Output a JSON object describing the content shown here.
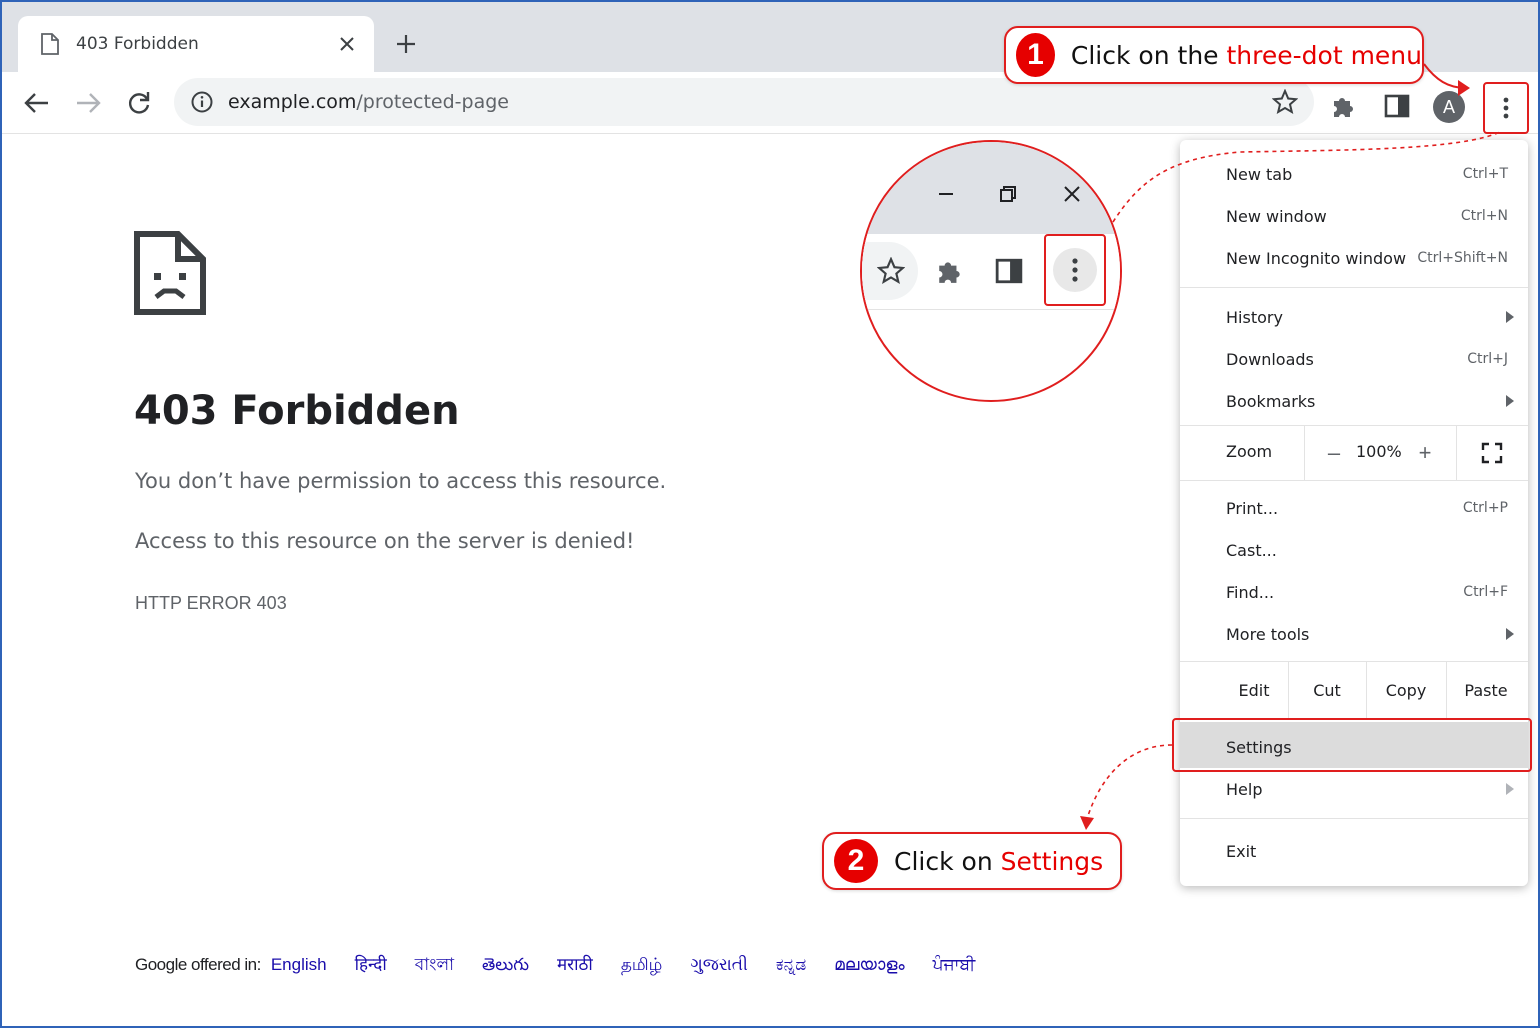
{
  "tab": {
    "title": "403 Forbidden"
  },
  "omnibox": {
    "domain": "example.com",
    "path": "/protected-page"
  },
  "avatar": {
    "initial": "A"
  },
  "page": {
    "title": "403 Forbidden",
    "message1": "You don’t have permission to access this resource.",
    "message2": "Access to this resource on the server is denied!",
    "code": "HTTP ERROR 403"
  },
  "languages": {
    "label": "Google offered in:",
    "items": [
      "English",
      "हिन्दी",
      "বাংলা",
      "తెలుగు",
      "मराठी",
      "தமிழ்",
      "ગુજરાતી",
      "ಕನ್ನಡ",
      "മലയാളം",
      "ਪੰਜਾਬੀ"
    ]
  },
  "menu": {
    "new_tab": {
      "label": "New tab",
      "shortcut": "Ctrl+T"
    },
    "new_window": {
      "label": "New window",
      "shortcut": "Ctrl+N"
    },
    "new_incognito": {
      "label": "New Incognito window",
      "shortcut": "Ctrl+Shift+N"
    },
    "history": {
      "label": "History"
    },
    "downloads": {
      "label": "Downloads",
      "shortcut": "Ctrl+J"
    },
    "bookmarks": {
      "label": "Bookmarks"
    },
    "zoom": {
      "label": "Zoom",
      "value": "100%",
      "minus": "–",
      "plus": "+"
    },
    "print": {
      "label": "Print...",
      "shortcut": "Ctrl+P"
    },
    "cast": {
      "label": "Cast..."
    },
    "find": {
      "label": "Find...",
      "shortcut": "Ctrl+F"
    },
    "more_tools": {
      "label": "More tools"
    },
    "edit": {
      "label": "Edit",
      "cut": "Cut",
      "copy": "Copy",
      "paste": "Paste"
    },
    "settings": {
      "label": "Settings"
    },
    "help": {
      "label": "Help"
    },
    "exit": {
      "label": "Exit"
    }
  },
  "callouts": {
    "step1": {
      "number": "1",
      "prefix": "Click on the ",
      "highlight": "three-dot menu"
    },
    "step2": {
      "number": "2",
      "prefix": "Click on ",
      "highlight": "Settings"
    }
  },
  "colors": {
    "accent_red": "#e60000",
    "link_blue": "#1a0dab",
    "avatar_bg": "#5f6368"
  },
  "icons": [
    "doc-icon",
    "close-icon",
    "plus-icon",
    "back-arrow-icon",
    "forward-arrow-icon",
    "reload-icon",
    "info-icon",
    "star-icon",
    "puzzle-icon",
    "side-panel-icon",
    "kebab-icon",
    "sad-page-icon",
    "minimize-icon",
    "restore-icon",
    "fullscreen-icon",
    "submenu-arrow-icon"
  ]
}
